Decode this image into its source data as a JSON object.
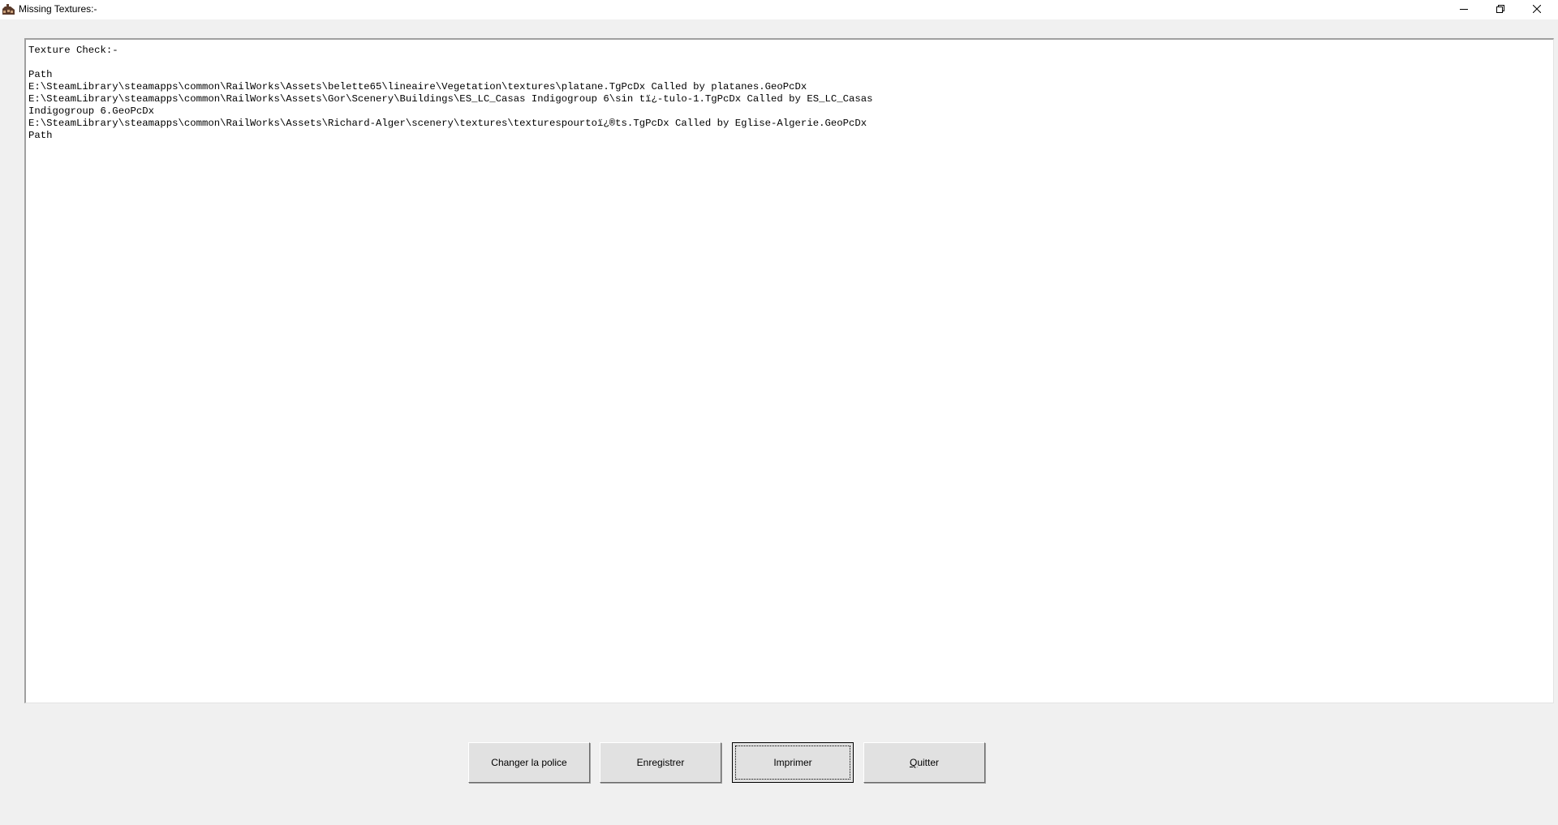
{
  "window": {
    "title": "Missing Textures:-"
  },
  "icons": {
    "app": "train-app-icon",
    "minimize": "minimize-icon",
    "maximize": "restore-icon",
    "close": "close-icon"
  },
  "report": {
    "lines": [
      "Texture Check:-",
      "",
      "Path",
      "E:\\SteamLibrary\\steamapps\\common\\RailWorks\\Assets\\belette65\\lineaire\\Vegetation\\textures\\platane.TgPcDx Called by platanes.GeoPcDx",
      "E:\\SteamLibrary\\steamapps\\common\\RailWorks\\Assets\\Gor\\Scenery\\Buildings\\ES_LC_Casas Indigogroup 6\\sin tï¿-tulo-1.TgPcDx Called by ES_LC_Casas",
      "Indigogroup 6.GeoPcDx",
      "E:\\SteamLibrary\\steamapps\\common\\RailWorks\\Assets\\Richard-Alger\\scenery\\textures\\texturespourtoï¿®ts.TgPcDx Called by Eglise-Algerie.GeoPcDx",
      "Path"
    ]
  },
  "buttons": {
    "change_font": "Changer la police",
    "save": "Enregistrer",
    "print": "Imprimer",
    "quit_first": "Q",
    "quit_rest": "uitter"
  },
  "colors": {
    "window_bg": "#f0f0f0",
    "titlebar_bg": "#ffffff",
    "text_bg": "#ffffff",
    "button_bg": "#e1e1e1"
  }
}
